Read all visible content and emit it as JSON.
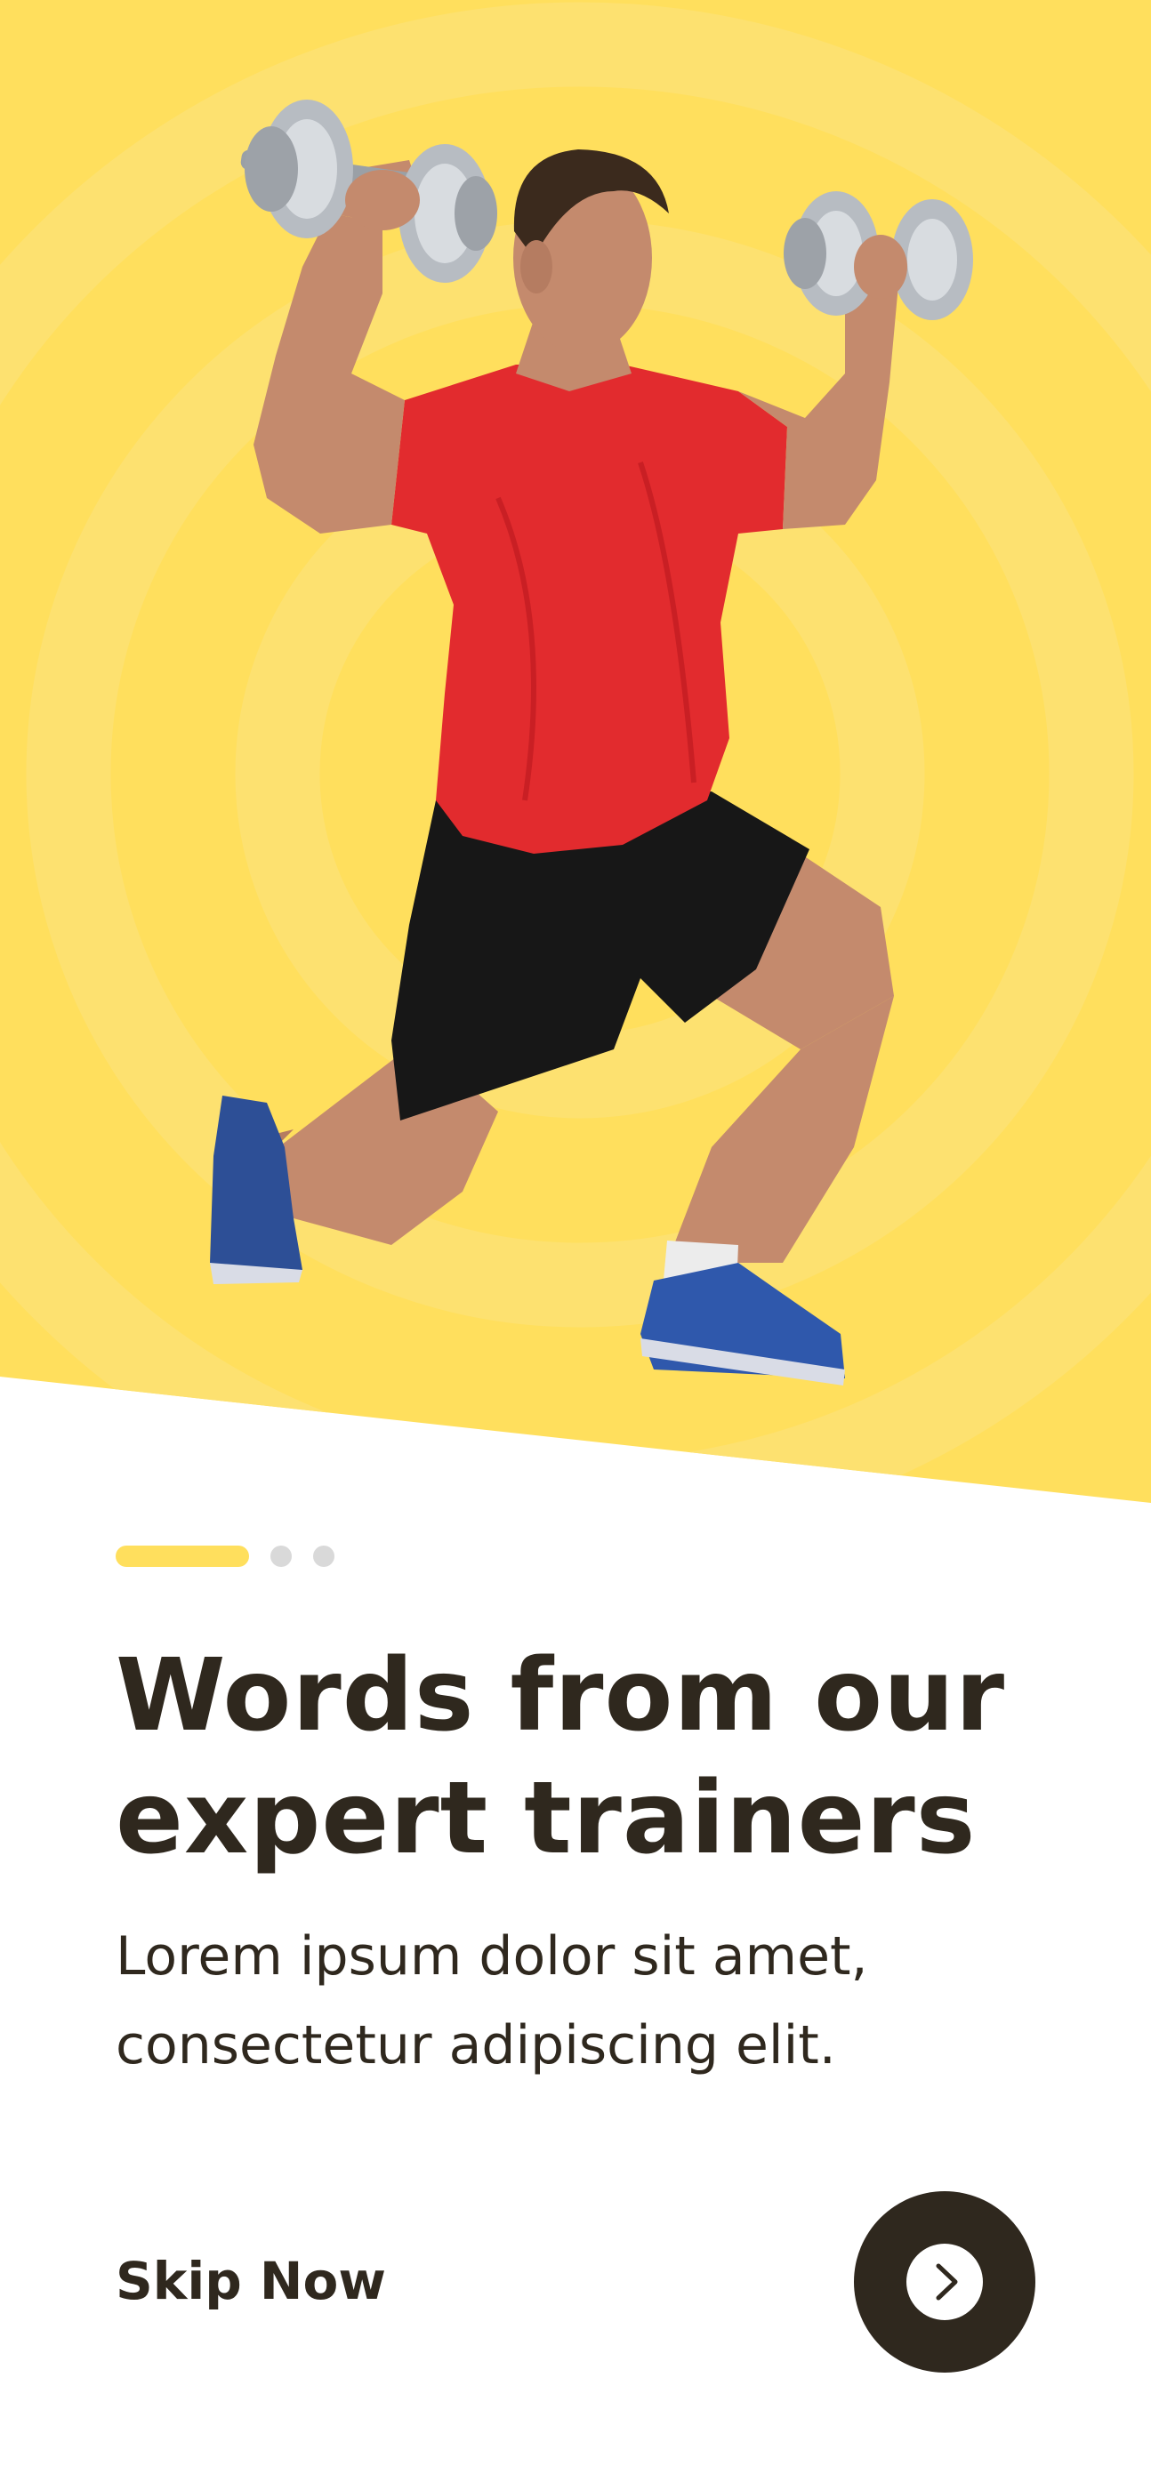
{
  "colors": {
    "hero_background": "#ffdf5d",
    "hero_ring": "#fde170",
    "accent": "#ffdf5d",
    "indicator_inactive": "#d9d9d9",
    "text_dark": "#2f281e",
    "button_dark": "#2f281e"
  },
  "hero": {
    "image": "man-lifting-dumbbells-in-lunge"
  },
  "pager": {
    "current_page": 1,
    "total_pages": 3
  },
  "onboarding": {
    "title": "Words from our expert trainers",
    "subtitle": "Lorem ipsum dolor sit amet, consectetur adipiscing elit."
  },
  "actions": {
    "skip_label": "Skip Now",
    "next_icon": "chevron-right-icon"
  }
}
